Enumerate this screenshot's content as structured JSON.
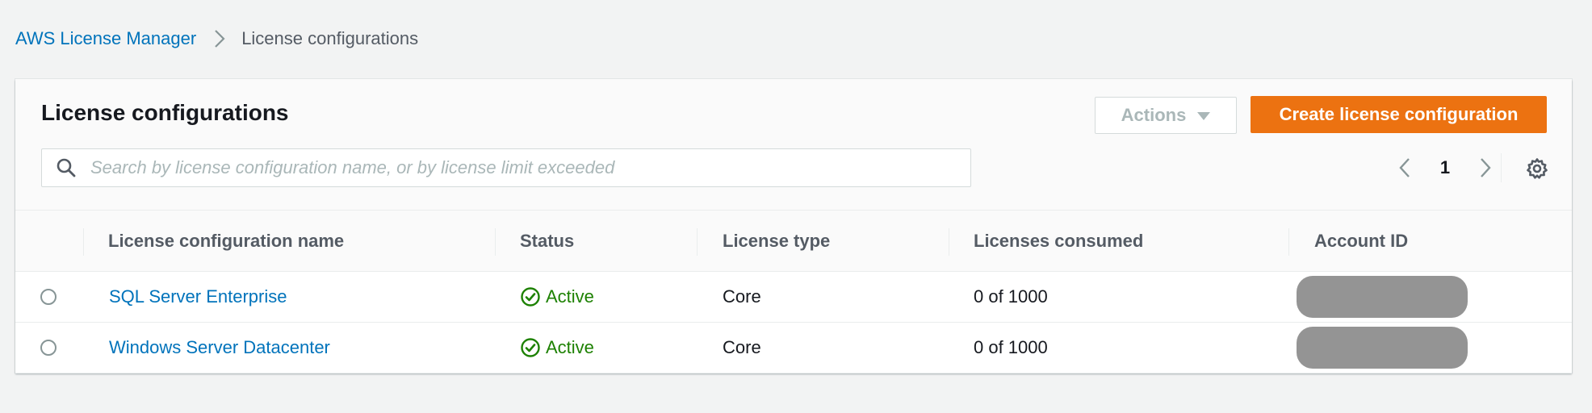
{
  "breadcrumb": {
    "root": "AWS License Manager",
    "current": "License configurations",
    "separator_icon": "chevron-right-icon"
  },
  "panel": {
    "title": "License configurations",
    "actions_label": "Actions",
    "create_label": "Create license configuration",
    "search_placeholder": "Search by license configuration name, or by license limit exceeded",
    "page_number": "1"
  },
  "colors": {
    "link": "#0073bb",
    "primary_button": "#ec7211",
    "status_active": "#1d8102",
    "redaction": "#949494"
  },
  "table": {
    "columns": [
      "License configuration name",
      "Status",
      "License type",
      "Licenses consumed",
      "Account ID"
    ],
    "rows": [
      {
        "name": "SQL Server Enterprise",
        "status": "Active",
        "license_type": "Core",
        "consumed": "0 of 1000",
        "account_id_redacted": true
      },
      {
        "name": "Windows Server Datacenter",
        "status": "Active",
        "license_type": "Core",
        "consumed": "0 of 1000",
        "account_id_redacted": true
      }
    ]
  }
}
